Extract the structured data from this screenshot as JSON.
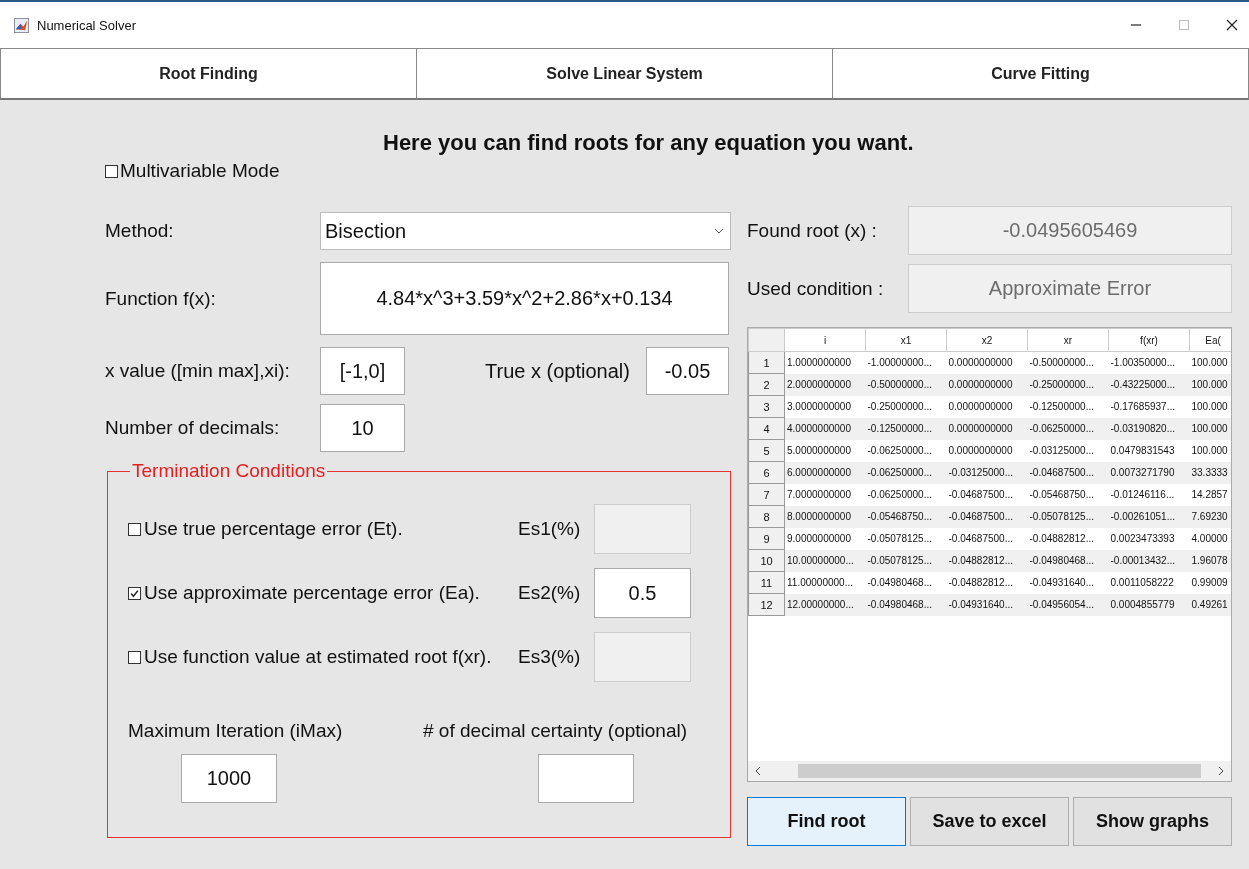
{
  "window": {
    "title": "Numerical Solver"
  },
  "tabs": [
    "Root Finding",
    "Solve Linear System",
    "Curve Fitting"
  ],
  "heading": "Here you can find roots for any equation you want.",
  "multivariable": {
    "label": "Multivariable Mode",
    "checked": false
  },
  "method": {
    "label": "Method:",
    "value": "Bisection"
  },
  "function": {
    "label": "Function f(x):",
    "value": "4.84*x^3+3.59*x^2+2.86*x+0.134"
  },
  "x_value": {
    "label": "x value ([min max],xi):",
    "value": "[-1,0]"
  },
  "true_x": {
    "label": "True x (optional)",
    "value": "-0.05"
  },
  "decimals": {
    "label": "Number of decimals:",
    "value": "10"
  },
  "termination": {
    "title": "Termination Conditions",
    "conditions": [
      {
        "label": "Use true percentage error (Et).",
        "checked": false,
        "es_label": "Es1(%)"
      },
      {
        "label": "Use approximate percentage error (Ea).",
        "checked": true,
        "es_label": "Es2(%)",
        "es_value": "0.5"
      },
      {
        "label": "Use function value at estimated root f(xr).",
        "checked": false,
        "es_label": "Es3(%)"
      }
    ],
    "max_iteration": {
      "label": "Maximum Iteration (iMax)",
      "value": "1000"
    },
    "decimal_certainty": {
      "label": "# of decimal certainty (optional)"
    }
  },
  "found_root": {
    "label": "Found root (x) :",
    "value": "-0.0495605469"
  },
  "used_condition": {
    "label": "Used condition :",
    "value": "Approximate Error"
  },
  "table": {
    "columns": [
      "i",
      "x1",
      "x2",
      "xr",
      "f(xr)",
      "Ea("
    ],
    "rows": [
      {
        "number": "1",
        "cells": [
          "1.0000000000",
          "-1.00000000...",
          "0.0000000000",
          "-0.50000000...",
          "-1.00350000...",
          "100.000"
        ]
      },
      {
        "number": "2",
        "cells": [
          "2.0000000000",
          "-0.50000000...",
          "0.0000000000",
          "-0.25000000...",
          "-0.43225000...",
          "100.000"
        ]
      },
      {
        "number": "3",
        "cells": [
          "3.0000000000",
          "-0.25000000...",
          "0.0000000000",
          "-0.12500000...",
          "-0.17685937...",
          "100.000"
        ]
      },
      {
        "number": "4",
        "cells": [
          "4.0000000000",
          "-0.12500000...",
          "0.0000000000",
          "-0.06250000...",
          "-0.03190820...",
          "100.000"
        ]
      },
      {
        "number": "5",
        "cells": [
          "5.0000000000",
          "-0.06250000...",
          "0.0000000000",
          "-0.03125000...",
          "0.0479831543",
          "100.000"
        ]
      },
      {
        "number": "6",
        "cells": [
          "6.0000000000",
          "-0.06250000...",
          "-0.03125000...",
          "-0.04687500...",
          "0.0073271790",
          "33.3333"
        ]
      },
      {
        "number": "7",
        "cells": [
          "7.0000000000",
          "-0.06250000...",
          "-0.04687500...",
          "-0.05468750...",
          "-0.01246116...",
          "14.2857"
        ]
      },
      {
        "number": "8",
        "cells": [
          "8.0000000000",
          "-0.05468750...",
          "-0.04687500...",
          "-0.05078125...",
          "-0.00261051...",
          "7.69230"
        ]
      },
      {
        "number": "9",
        "cells": [
          "9.0000000000",
          "-0.05078125...",
          "-0.04687500...",
          "-0.04882812...",
          "0.0023473393",
          "4.00000"
        ]
      },
      {
        "number": "10",
        "cells": [
          "10.00000000...",
          "-0.05078125...",
          "-0.04882812...",
          "-0.04980468...",
          "-0.00013432...",
          "1.96078"
        ]
      },
      {
        "number": "11",
        "cells": [
          "11.00000000...",
          "-0.04980468...",
          "-0.04882812...",
          "-0.04931640...",
          "0.0011058222",
          "0.99009"
        ]
      },
      {
        "number": "12",
        "cells": [
          "12.00000000...",
          "-0.04980468...",
          "-0.04931640...",
          "-0.04956054...",
          "0.0004855779",
          "0.49261"
        ]
      }
    ]
  },
  "buttons": [
    {
      "label": "Find root",
      "selected": true
    },
    {
      "label": "Save to excel",
      "selected": false
    },
    {
      "label": "Show graphs",
      "selected": false
    }
  ]
}
